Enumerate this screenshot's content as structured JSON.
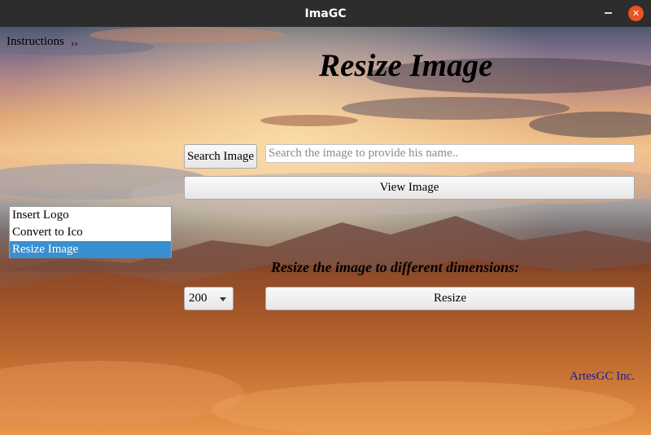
{
  "window": {
    "title": "ImaGC",
    "minimize_icon": "minimize-icon",
    "close_icon": "close-icon",
    "close_glyph": "✕"
  },
  "menu": {
    "instructions_label": "Instructions",
    "chevron": "››"
  },
  "heading": "Resize Image",
  "search": {
    "button_label": "Search Image",
    "placeholder": "Search the image to provide his name..",
    "value": ""
  },
  "view_button_label": "View Image",
  "tools_list": {
    "items": [
      "Insert Logo",
      "Convert to Ico",
      "Resize Image"
    ],
    "selected": "Resize Image"
  },
  "resize": {
    "subheading": "Resize the image to different dimensions:",
    "size_value": "200",
    "button_label": "Resize"
  },
  "credit": "ArtesGC Inc.",
  "colors": {
    "titlebar": "#2d2d2d",
    "close_button": "#e95420",
    "selection": "#3a8fd0",
    "credit_text": "#1a1aa6"
  }
}
